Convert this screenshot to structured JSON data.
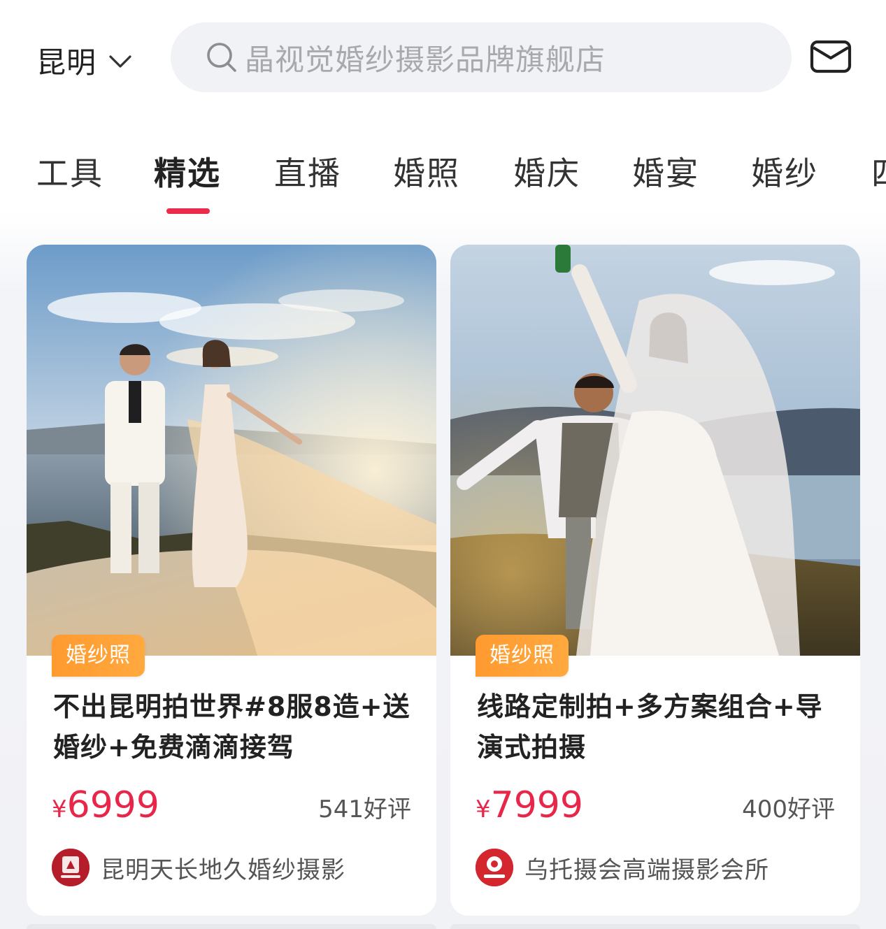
{
  "header": {
    "city": "昆明",
    "search_placeholder": "晶视觉婚纱摄影品牌旗舰店"
  },
  "tabs": [
    {
      "label": "工具"
    },
    {
      "label": "精选",
      "active": true
    },
    {
      "label": "直播"
    },
    {
      "label": "婚照"
    },
    {
      "label": "婚庆"
    },
    {
      "label": "婚宴"
    },
    {
      "label": "婚纱"
    },
    {
      "label": "四"
    }
  ],
  "colors": {
    "accent": "#ec2a49",
    "price": "#e8264a",
    "tag": "#ffa03a"
  },
  "cards": [
    {
      "tag": "婚纱照",
      "title": "不出昆明拍世界#8服8造+送婚纱+免费滴滴接驾",
      "currency": "¥",
      "price": "6999",
      "reviews": "541好评",
      "shop": "昆明天长地久婚纱摄影"
    },
    {
      "tag": "婚纱照",
      "title": "线路定制拍+多方案组合+导演式拍摄",
      "currency": "¥",
      "price": "7999",
      "reviews": "400好评",
      "shop": "乌托摄会高端摄影会所"
    }
  ]
}
